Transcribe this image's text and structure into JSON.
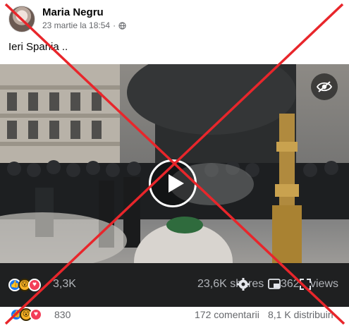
{
  "post": {
    "author": "Maria Negru",
    "timestamp": "23 martie la 18:54",
    "separator": "·",
    "text": "Ieri Spania .."
  },
  "video": {
    "overlay": {
      "reactions_count": "3,3K",
      "shares": "23,6K shares",
      "views_number": "362",
      "views_suffix": "views"
    },
    "icons": [
      "eye-off-icon",
      "play-icon",
      "gear-icon",
      "pip-icon",
      "fullscreen-icon"
    ]
  },
  "footer": {
    "reactions_count": "830",
    "comments": "172 comentarii",
    "shares": "8,1 K distribuiri"
  },
  "colors": {
    "cross": "#e8262b",
    "like": "#1877f2",
    "love": "#f33e58",
    "wow": "#f7b125",
    "meta_text": "#65676b",
    "dark_bar": "#1f2021"
  }
}
